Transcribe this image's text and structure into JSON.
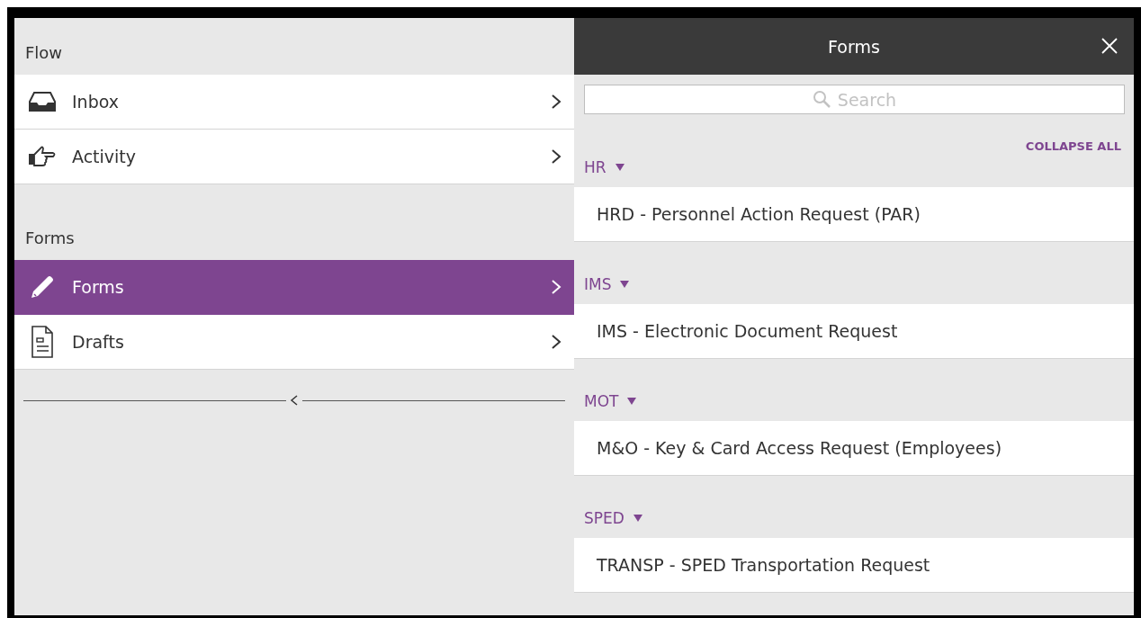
{
  "sidebar": {
    "sections": [
      {
        "title": "Flow",
        "items": [
          {
            "label": "Inbox",
            "selected": false
          },
          {
            "label": "Activity",
            "selected": false
          }
        ]
      },
      {
        "title": "Forms",
        "items": [
          {
            "label": "Forms",
            "selected": true
          },
          {
            "label": "Drafts",
            "selected": false
          }
        ]
      }
    ]
  },
  "panel": {
    "title": "Forms",
    "search": {
      "placeholder": "Search"
    },
    "collapse_all": "COLLAPSE ALL",
    "groups": [
      {
        "name": "HR",
        "expanded": true,
        "items": [
          "HRD - Personnel Action Request (PAR)"
        ]
      },
      {
        "name": "IMS",
        "expanded": true,
        "items": [
          "IMS - Electronic Document Request"
        ]
      },
      {
        "name": "MOT",
        "expanded": true,
        "items": [
          "M&O - Key & Card Access Request (Employees)"
        ]
      },
      {
        "name": "SPED",
        "expanded": true,
        "items": [
          "TRANSP - SPED Transportation Request"
        ]
      }
    ]
  }
}
